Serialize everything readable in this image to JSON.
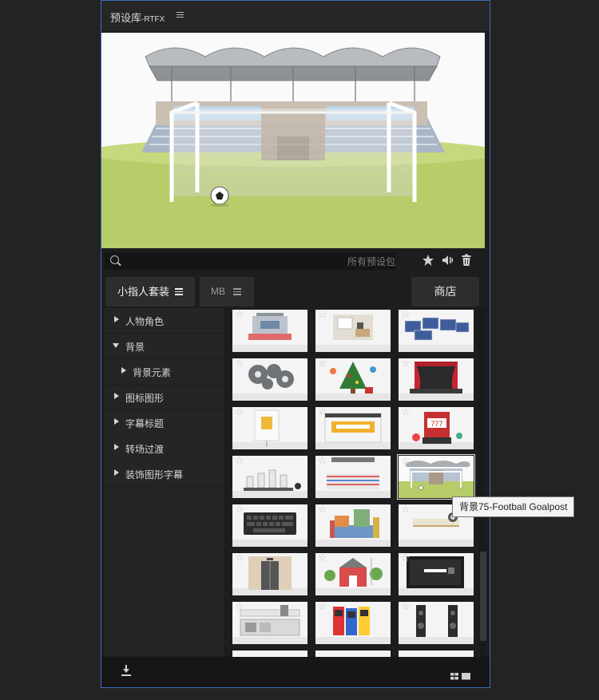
{
  "panel": {
    "title_main": "预设库",
    "title_suffix": "-RTFX"
  },
  "search": {
    "placeholder": "所有预设包"
  },
  "toolbar": {
    "favorite_icon": "star-icon",
    "audio_icon": "speaker-icon",
    "delete_icon": "trash-icon"
  },
  "tabs": [
    {
      "label": "小指人套装",
      "active": true
    },
    {
      "label": "MB",
      "active": false
    }
  ],
  "store_label": "商店",
  "categories": [
    {
      "label": "人物角色",
      "expanded": false,
      "level": 0
    },
    {
      "label": "背景",
      "expanded": true,
      "level": 0
    },
    {
      "label": "背景元素",
      "expanded": false,
      "level": 1
    },
    {
      "label": "图标图形",
      "expanded": false,
      "level": 0
    },
    {
      "label": "字幕标题",
      "expanded": false,
      "level": 0
    },
    {
      "label": "转场过渡",
      "expanded": false,
      "level": 0
    },
    {
      "label": "装饰图形字幕",
      "expanded": false,
      "level": 0
    }
  ],
  "thumbnails": [
    "stadium-seats",
    "office-desk",
    "solar-panels",
    "gears",
    "christmas-tree",
    "stage-curtain",
    "presentation-board",
    "web-page-mockup",
    "slot-machine",
    "chess-pieces",
    "boxing-ring",
    "football-goalpost",
    "keyboard",
    "bookshelf-city",
    "wall-shelf",
    "elevator",
    "barn",
    "wide-screen-tv",
    "kitchen",
    "arcade-machines",
    "speakers"
  ],
  "selected_index": 11,
  "tooltip": "背景75-Football Goalpost",
  "colors": {
    "accent_border": "#3b6fb8",
    "panel_bg": "#1d1d1d",
    "grass": "#b6cd6a"
  }
}
